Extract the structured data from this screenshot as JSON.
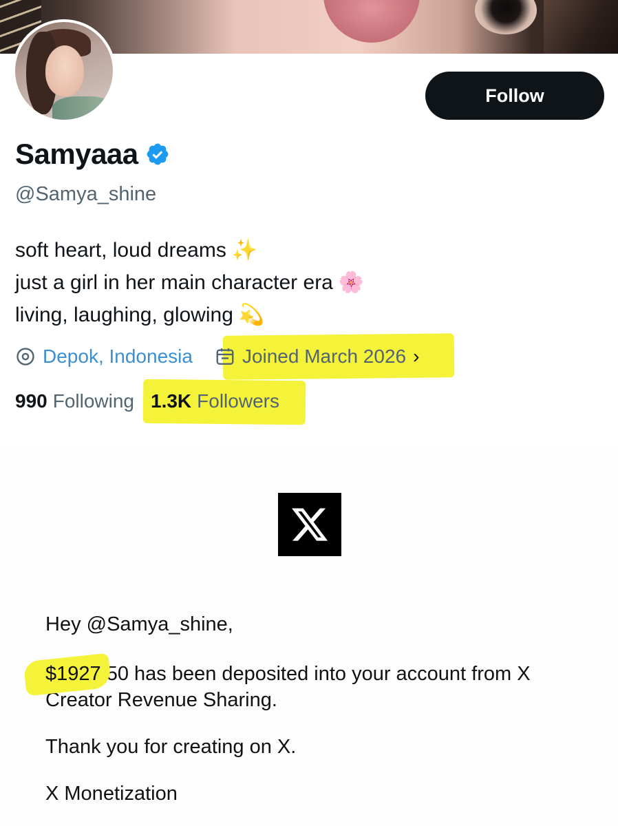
{
  "profile": {
    "follow_label": "Follow",
    "display_name": "Samyaaa",
    "handle": "@Samya_shine",
    "bio": [
      {
        "text": "soft heart, loud dreams",
        "emoji": "✨"
      },
      {
        "text": "just a girl in her main character era",
        "emoji": "🌸"
      },
      {
        "text": "living, laughing, glowing",
        "emoji": "💫"
      }
    ],
    "location": "Depok, Indonesia",
    "joined": "Joined March 2026",
    "following_count": "990",
    "following_label": "Following",
    "followers_count": "1.3K",
    "followers_label": "Followers"
  },
  "email": {
    "greeting": "Hey @Samya_shine,",
    "amount_highlighted": "$1927",
    "amount_rest": ".50",
    "deposit_text": " has been deposited into your account from X Creator Revenue Sharing.",
    "thanks": "Thank you for creating on X.",
    "signoff": "X Monetization"
  },
  "colors": {
    "highlight": "#f5f23a",
    "link": "#3a8fd3",
    "verified": "#1d9bf0",
    "button_bg": "#0f1419"
  },
  "icons": {
    "verified": "verified-badge-icon",
    "location": "location-pin-icon",
    "calendar": "calendar-icon",
    "chevron": "chevron-right-icon",
    "brand": "x-logo-icon"
  }
}
